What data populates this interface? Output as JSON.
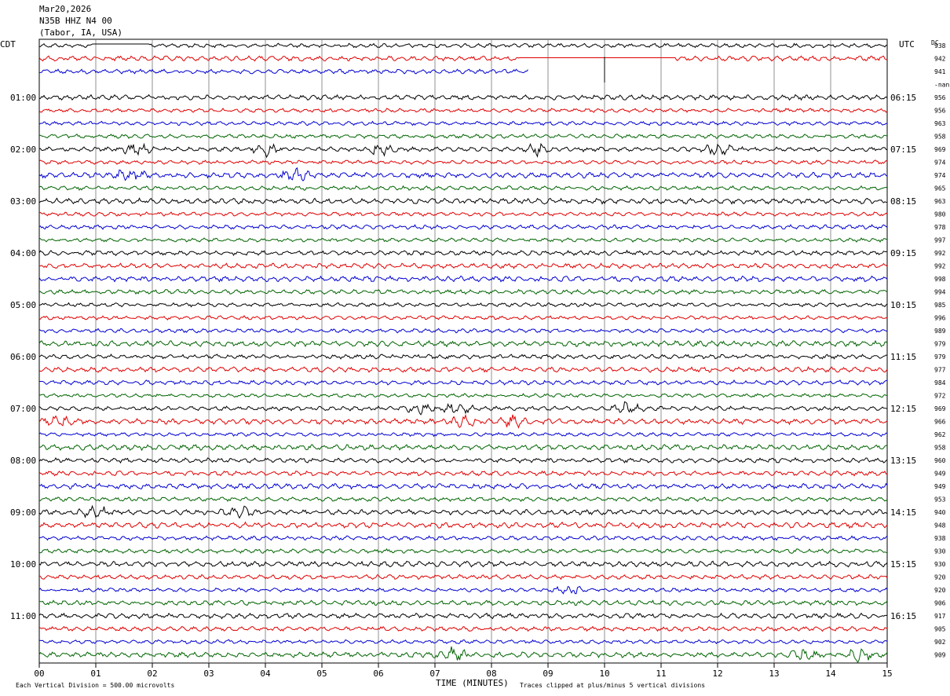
{
  "header": {
    "date": "Mar20,2026",
    "station": "N35B HHZ N4 00",
    "location": "(Tabor, IA, USA)"
  },
  "left_zone": "CDT",
  "right_zone": "UTC",
  "dc_label": "DC",
  "footer": {
    "scale": "Each Vertical Division =  500.00 microvolts",
    "clip_note": "Traces clipped at plus/minus 5 vertical divisions"
  },
  "chart_data": {
    "type": "line",
    "title": "",
    "xlabel": "TIME (MINUTES)",
    "x_ticks": [
      "00",
      "01",
      "02",
      "03",
      "04",
      "05",
      "06",
      "07",
      "08",
      "09",
      "10",
      "11",
      "12",
      "13",
      "14",
      "15"
    ],
    "xlim": [
      0,
      15
    ],
    "grid": "vertical lines every minute",
    "trace_colors": [
      "#000000",
      "#e00000",
      "#0000d0",
      "#006400"
    ],
    "left_hour_labels": [
      "01:00",
      "02:00",
      "03:00",
      "04:00",
      "05:00",
      "06:00",
      "07:00",
      "08:00",
      "09:00",
      "10:00",
      "11:00"
    ],
    "right_hour_labels": [
      "06:15",
      "07:15",
      "08:15",
      "09:15",
      "10:15",
      "11:15",
      "12:15",
      "13:15",
      "14:15",
      "15:15",
      "16:15"
    ],
    "dc_values": [
      "938",
      "942",
      "941",
      "-nan",
      "956",
      "956",
      "963",
      "958",
      "969",
      "974",
      "974",
      "965",
      "963",
      "980",
      "978",
      "997",
      "992",
      "992",
      "998",
      "994",
      "985",
      "996",
      "989",
      "979",
      "979",
      "977",
      "984",
      "972",
      "969",
      "966",
      "962",
      "958",
      "960",
      "949",
      "949",
      "953",
      "940",
      "948",
      "938",
      "930",
      "930",
      "920",
      "920",
      "906",
      "917",
      "905",
      "902",
      "909"
    ],
    "row_count": 48,
    "missing_row_index": 3,
    "gaps": [
      {
        "row": 0,
        "from_min": 0.95,
        "to_min": 1.95
      },
      {
        "row": 1,
        "from_min": 8.5,
        "to_min": 11.25
      },
      {
        "row": 2,
        "from_min": 8.65,
        "to_min": 15
      }
    ],
    "bursts": [
      {
        "row": 8,
        "at_min": [
          1.7,
          4.0,
          6.0,
          8.8,
          12.0
        ]
      },
      {
        "row": 10,
        "at_min": [
          1.6,
          4.5
        ]
      },
      {
        "row": 28,
        "at_min": [
          6.7,
          7.4,
          10.4
        ]
      },
      {
        "row": 29,
        "at_min": [
          0.3,
          7.5,
          8.4
        ]
      },
      {
        "row": 36,
        "at_min": [
          1.0,
          3.5
        ]
      },
      {
        "row": 42,
        "at_min": [
          9.4
        ]
      },
      {
        "row": 47,
        "at_min": [
          7.3,
          13.5,
          14.5
        ]
      }
    ]
  }
}
